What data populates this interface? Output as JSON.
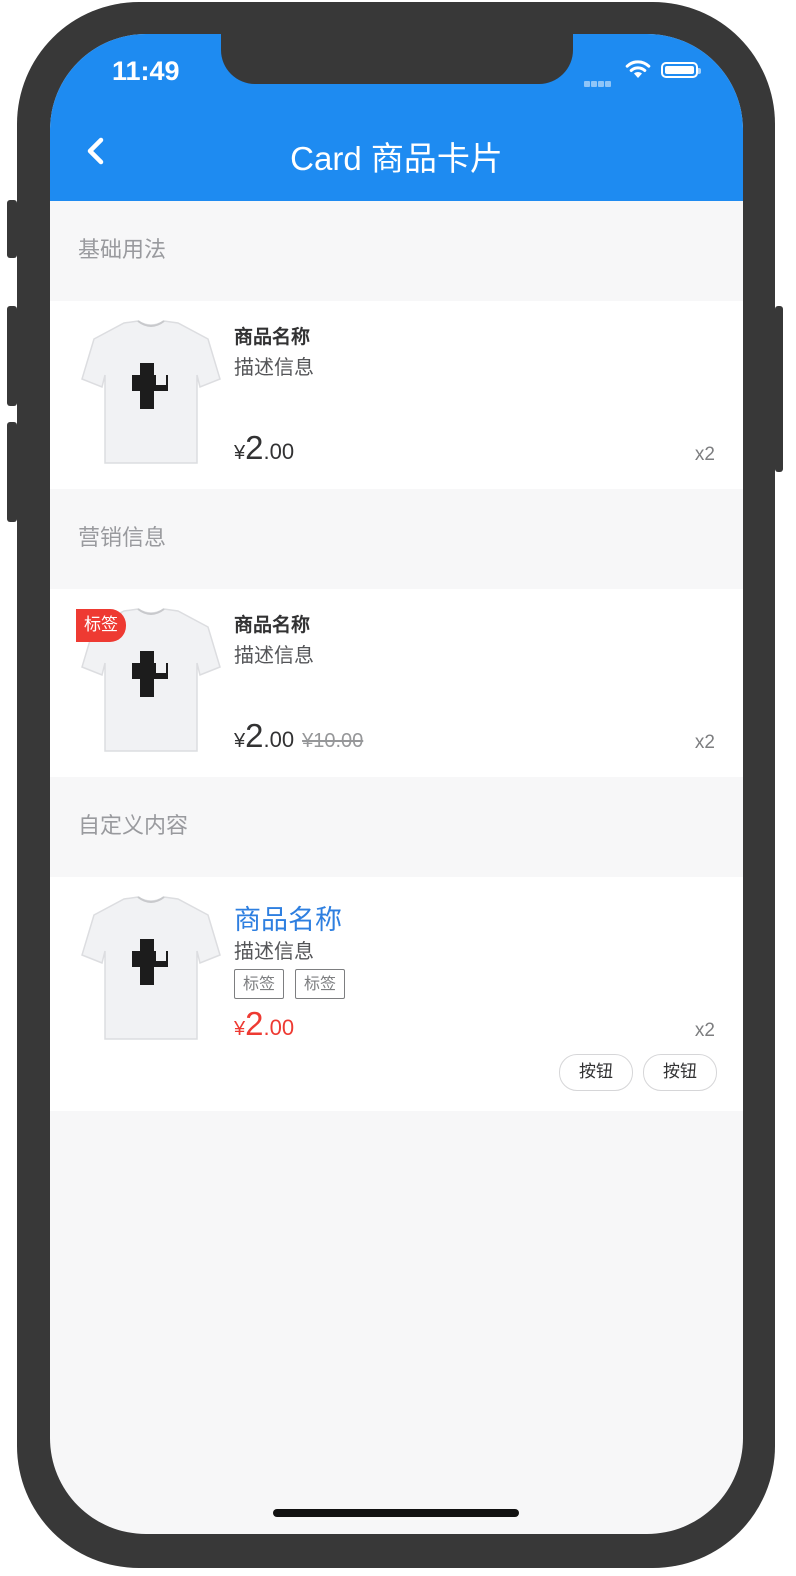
{
  "status_bar": {
    "time": "11:49"
  },
  "nav": {
    "title": "Card 商品卡片"
  },
  "sections": [
    {
      "title": "基础用法",
      "card": {
        "name": "商品名称",
        "desc": "描述信息",
        "currency": "¥",
        "price_int": "2",
        "price_dec": ".00",
        "qty": "x2"
      }
    },
    {
      "title": "营销信息",
      "card": {
        "tag": "标签",
        "name": "商品名称",
        "desc": "描述信息",
        "currency": "¥",
        "price_int": "2",
        "price_dec": ".00",
        "origin_price": "¥10.00",
        "qty": "x2"
      }
    },
    {
      "title": "自定义内容",
      "card": {
        "name": "商品名称",
        "desc": "描述信息",
        "tags": [
          "标签",
          "标签"
        ],
        "currency": "¥",
        "price_int": "2",
        "price_dec": ".00",
        "qty": "x2",
        "buttons": [
          "按钮",
          "按钮"
        ]
      }
    }
  ],
  "colors": {
    "primary": "#1e8bf1",
    "danger": "#ee3a32",
    "title_blue": "#2e7fe0"
  }
}
